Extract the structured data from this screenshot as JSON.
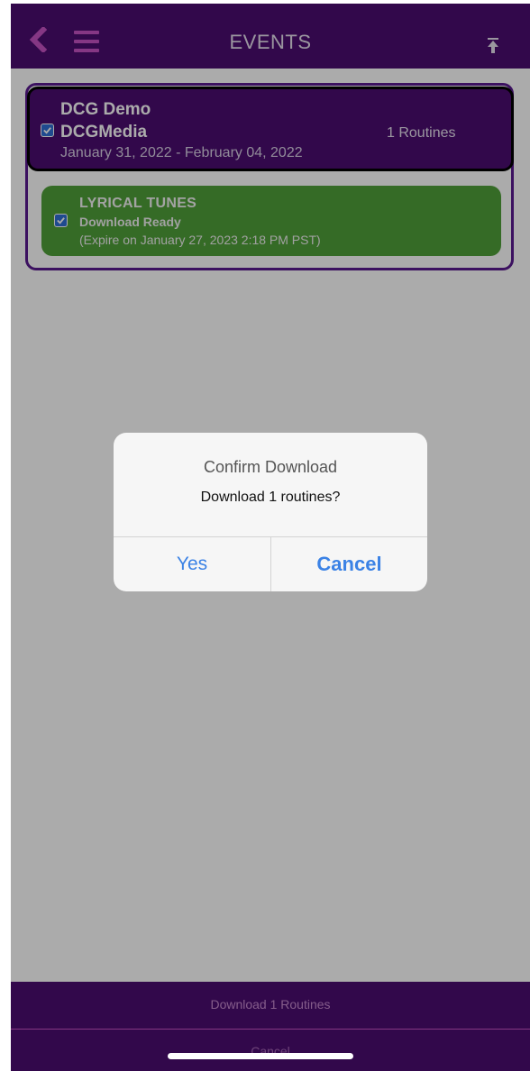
{
  "header": {
    "title": "EVENTS",
    "back_icon": "chevron-left-icon",
    "menu_icon": "hamburger-menu-icon",
    "upload_icon": "upload-arrow-icon",
    "accent_color": "#c653c5",
    "background_color": "#4b0c70"
  },
  "event": {
    "name_line1": "DCG Demo",
    "name_line2": "DCGMedia",
    "dates": "January 31, 2022 - February 04, 2022",
    "routine_count": "1 Routines",
    "checked": true
  },
  "routine": {
    "title": "LYRICAL TUNES",
    "status": "Download Ready",
    "expiry": "(Expire on January 27, 2023 2:18 PM PST)",
    "checked": true,
    "color": "#50a03a"
  },
  "bottom_bar": {
    "download_label": "Download 1 Routines",
    "cancel_label": "Cancel"
  },
  "dialog": {
    "title": "Confirm Download",
    "message": "Download 1 routines?",
    "yes_label": "Yes",
    "cancel_label": "Cancel",
    "button_color": "#3b82e5"
  }
}
